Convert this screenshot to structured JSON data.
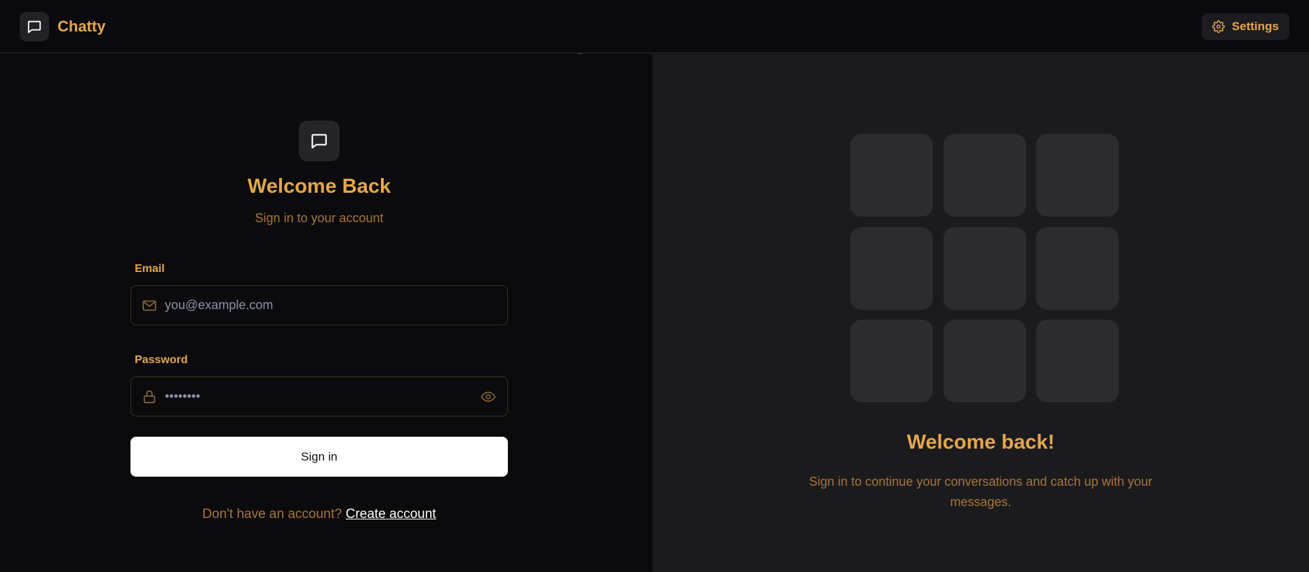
{
  "app": {
    "name": "Chatty"
  },
  "header": {
    "settings_label": "Settings"
  },
  "login": {
    "title": "Welcome Back",
    "subtitle": "Sign in to your account",
    "email_label": "Email",
    "email_placeholder": "you@example.com",
    "email_value": "",
    "password_label": "Password",
    "password_value": "••••••••",
    "signin_label": "Sign in",
    "signup_prompt": "Don't have an account?",
    "signup_link": "Create account"
  },
  "promo": {
    "title": "Welcome back!",
    "description": "Sign in to continue your conversations and catch up with your messages."
  },
  "icons": {
    "brand": "chat-bubble-icon",
    "settings": "gear-icon",
    "email": "mail-icon",
    "password": "lock-icon",
    "toggle": "eye-icon"
  },
  "colors": {
    "accent": "#e5a64a",
    "muted_accent": "#a8743a",
    "background": "#0b0b0d",
    "panel": "#1b1b1e",
    "tile": "#2c2c30"
  }
}
